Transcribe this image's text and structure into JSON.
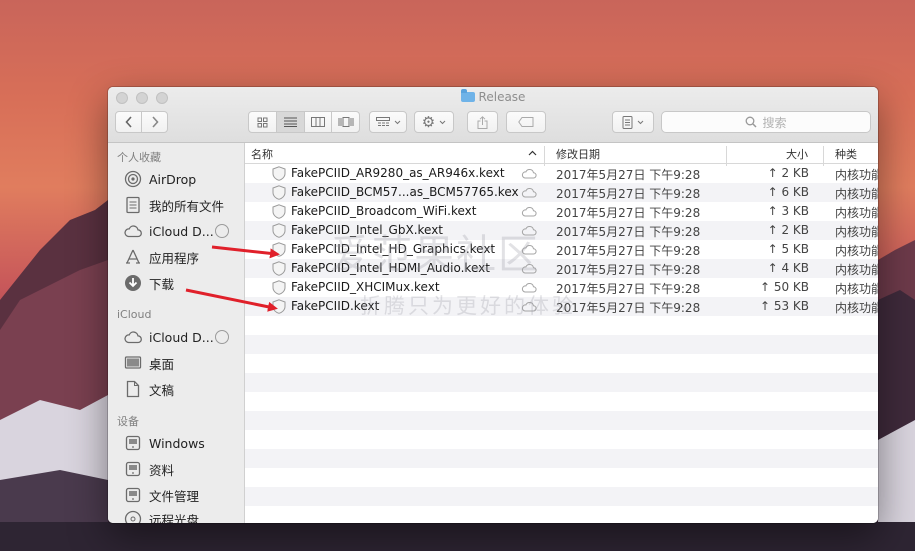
{
  "window": {
    "title": "Release"
  },
  "toolbar": {
    "back_icon": "chevron-left-icon",
    "forward_icon": "chevron-right-icon",
    "view_icons": [
      "grid-icon",
      "list-icon",
      "columns-icon",
      "coverflow-icon"
    ],
    "arrange_icon": "arrange-icon",
    "action_icon": "gear-icon",
    "share_icon": "share-icon",
    "tag_icon": "tag-icon",
    "path_icon": "path-icon",
    "search_placeholder": "搜索"
  },
  "sidebar": {
    "sections": [
      {
        "heading": "个人收藏",
        "items": [
          {
            "label": "AirDrop",
            "icon": "airdrop-icon"
          },
          {
            "label": "我的所有文件",
            "icon": "all-files-icon"
          },
          {
            "label": "iCloud D...",
            "icon": "cloud-icon"
          },
          {
            "label": "应用程序",
            "icon": "applications-icon"
          },
          {
            "label": "下载",
            "icon": "download-icon"
          }
        ]
      },
      {
        "heading": "iCloud",
        "items": [
          {
            "label": "iCloud D...",
            "icon": "cloud-icon"
          },
          {
            "label": "桌面",
            "icon": "desktop-icon"
          },
          {
            "label": "文稿",
            "icon": "documents-icon"
          }
        ]
      },
      {
        "heading": "设备",
        "items": [
          {
            "label": "Windows",
            "icon": "disk-icon"
          },
          {
            "label": "资料",
            "icon": "disk-icon"
          },
          {
            "label": "文件管理",
            "icon": "disk-icon"
          },
          {
            "label": "远程光盘",
            "icon": "optical-disc-icon"
          }
        ]
      }
    ]
  },
  "columns": {
    "name": "名称",
    "date": "修改日期",
    "size": "大小",
    "kind": "种类"
  },
  "files": [
    {
      "name": "FakePCIID_AR9280_as_AR946x.kext",
      "date": "2017年5月27日 下午9:28",
      "size": "2 KB",
      "kind": "内核功能"
    },
    {
      "name": "FakePCIID_BCM57...as_BCM57765.kext",
      "date": "2017年5月27日 下午9:28",
      "size": "6 KB",
      "kind": "内核功能"
    },
    {
      "name": "FakePCIID_Broadcom_WiFi.kext",
      "date": "2017年5月27日 下午9:28",
      "size": "3 KB",
      "kind": "内核功能"
    },
    {
      "name": "FakePCIID_Intel_GbX.kext",
      "date": "2017年5月27日 下午9:28",
      "size": "2 KB",
      "kind": "内核功能"
    },
    {
      "name": "FakePCIID_Intel_HD_Graphics.kext",
      "date": "2017年5月27日 下午9:28",
      "size": "5 KB",
      "kind": "内核功能"
    },
    {
      "name": "FakePCIID_Intel_HDMI_Audio.kext",
      "date": "2017年5月27日 下午9:28",
      "size": "4 KB",
      "kind": "内核功能"
    },
    {
      "name": "FakePCIID_XHCIMux.kext",
      "date": "2017年5月27日 下午9:28",
      "size": "50 KB",
      "kind": "内核功能"
    },
    {
      "name": "FakePCIID.kext",
      "date": "2017年5月27日 下午9:28",
      "size": "53 KB",
      "kind": "内核功能"
    }
  ],
  "watermark": {
    "main": "爱范果社区",
    "sub": "折腾只为更好的体验"
  },
  "colors": {
    "arrow": "#e0202a",
    "folder": "#6fb3e8",
    "selection": "#d8d8d8"
  }
}
